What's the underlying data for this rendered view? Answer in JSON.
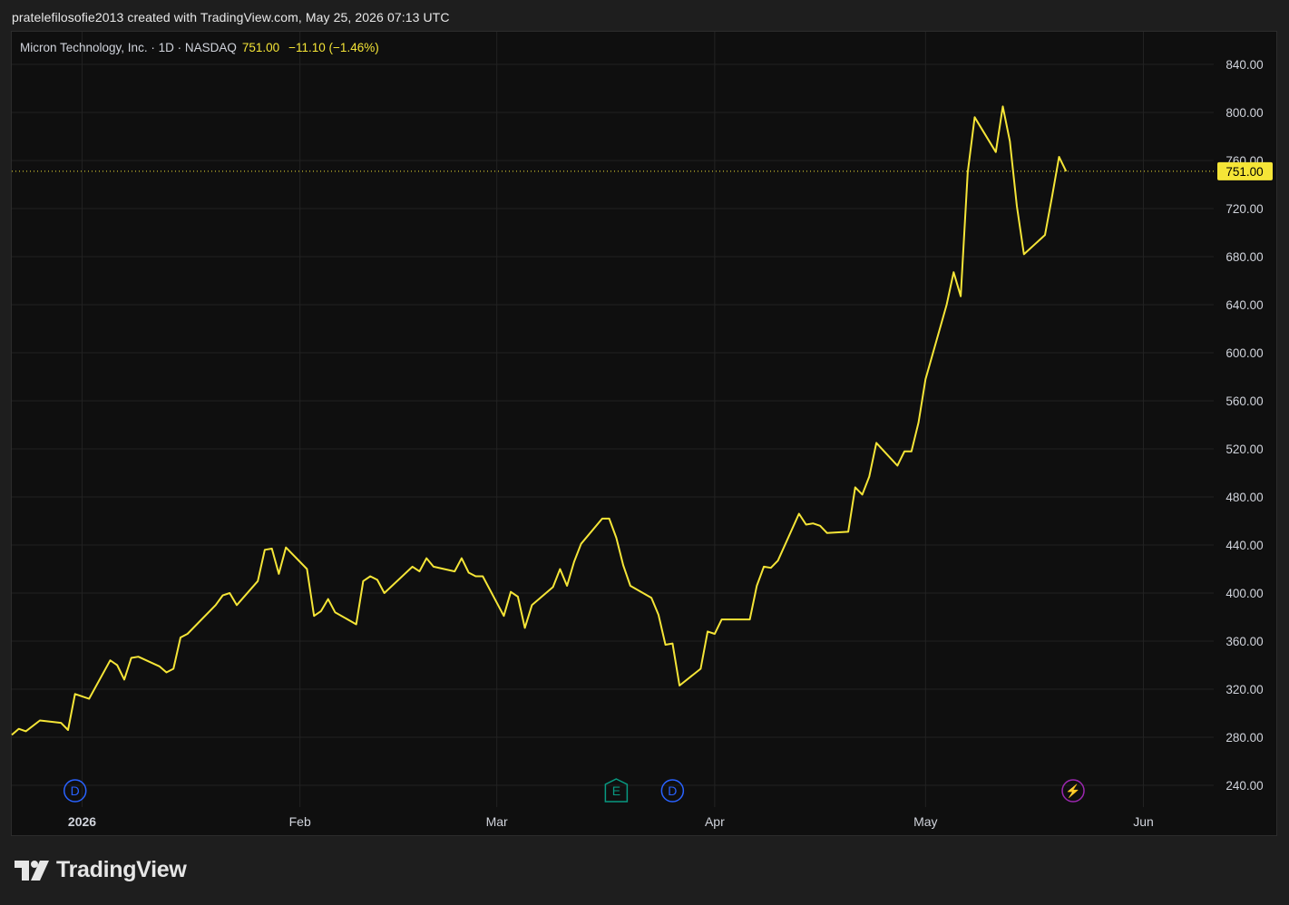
{
  "header": {
    "caption": "pratelefilosofie2013 created with TradingView.com, May 25, 2026 07:13 UTC"
  },
  "legend": {
    "symbol": "Micron Technology, Inc. · 1D · NASDAQ",
    "price": "751.00",
    "change": "−11.10 (−1.46%)"
  },
  "logo": {
    "text": "TradingView"
  },
  "colors": {
    "line": "#f5e537",
    "background": "#0f0f0f",
    "grid": "#222222",
    "dividend_marker": "#2962ff",
    "earnings_marker": "#089981",
    "split_marker": "#9c27b0"
  },
  "chart_data": {
    "type": "line",
    "title": "Micron Technology, Inc. · 1D · NASDAQ",
    "last_price_label": "751.00",
    "ylim": [
      220,
      860
    ],
    "y_ticks": [
      "840.00",
      "800.00",
      "760.00",
      "720.00",
      "680.00",
      "640.00",
      "600.00",
      "560.00",
      "520.00",
      "480.00",
      "440.00",
      "400.00",
      "360.00",
      "320.00",
      "280.00",
      "240.00"
    ],
    "x_ticks": [
      {
        "label": "2026",
        "date": "2026-01-01",
        "bold": true
      },
      {
        "label": "Feb",
        "date": "2026-02-01"
      },
      {
        "label": "Mar",
        "date": "2026-03-01"
      },
      {
        "label": "Apr",
        "date": "2026-04-01"
      },
      {
        "label": "May",
        "date": "2026-05-01"
      },
      {
        "label": "Jun",
        "date": "2026-06-01"
      }
    ],
    "xlim": [
      "2025-12-22",
      "2026-06-11"
    ],
    "grid": true,
    "markers": [
      {
        "type": "D",
        "date": "2025-12-31",
        "kind": "dividend"
      },
      {
        "type": "E",
        "date": "2026-03-18",
        "kind": "earnings"
      },
      {
        "type": "D",
        "date": "2026-03-26",
        "kind": "dividend"
      },
      {
        "type": "⚡",
        "date": "2026-05-22",
        "kind": "split"
      }
    ],
    "series": [
      {
        "points": [
          [
            "2025-12-22",
            282
          ],
          [
            "2025-12-23",
            287
          ],
          [
            "2025-12-24",
            285
          ],
          [
            "2025-12-26",
            294
          ],
          [
            "2025-12-29",
            292
          ],
          [
            "2025-12-30",
            286
          ],
          [
            "2025-12-31",
            316
          ],
          [
            "2026-01-02",
            312
          ],
          [
            "2026-01-05",
            344
          ],
          [
            "2026-01-06",
            340
          ],
          [
            "2026-01-07",
            328
          ],
          [
            "2026-01-08",
            346
          ],
          [
            "2026-01-09",
            347
          ],
          [
            "2026-01-12",
            339
          ],
          [
            "2026-01-13",
            334
          ],
          [
            "2026-01-14",
            337
          ],
          [
            "2026-01-15",
            363
          ],
          [
            "2026-01-16",
            366
          ],
          [
            "2026-01-20",
            390
          ],
          [
            "2026-01-21",
            398
          ],
          [
            "2026-01-22",
            400
          ],
          [
            "2026-01-23",
            390
          ],
          [
            "2026-01-26",
            410
          ],
          [
            "2026-01-27",
            436
          ],
          [
            "2026-01-28",
            437
          ],
          [
            "2026-01-29",
            416
          ],
          [
            "2026-01-30",
            438
          ],
          [
            "2026-02-02",
            420
          ],
          [
            "2026-02-03",
            381
          ],
          [
            "2026-02-04",
            385
          ],
          [
            "2026-02-05",
            395
          ],
          [
            "2026-02-06",
            384
          ],
          [
            "2026-02-09",
            374
          ],
          [
            "2026-02-10",
            410
          ],
          [
            "2026-02-11",
            414
          ],
          [
            "2026-02-12",
            411
          ],
          [
            "2026-02-13",
            400
          ],
          [
            "2026-02-17",
            422
          ],
          [
            "2026-02-18",
            418
          ],
          [
            "2026-02-19",
            429
          ],
          [
            "2026-02-20",
            422
          ],
          [
            "2026-02-23",
            418
          ],
          [
            "2026-02-24",
            429
          ],
          [
            "2026-02-25",
            417
          ],
          [
            "2026-02-26",
            414
          ],
          [
            "2026-02-27",
            414
          ],
          [
            "2026-03-02",
            381
          ],
          [
            "2026-03-03",
            401
          ],
          [
            "2026-03-04",
            397
          ],
          [
            "2026-03-05",
            371
          ],
          [
            "2026-03-06",
            390
          ],
          [
            "2026-03-09",
            405
          ],
          [
            "2026-03-10",
            420
          ],
          [
            "2026-03-11",
            406
          ],
          [
            "2026-03-12",
            426
          ],
          [
            "2026-03-13",
            441
          ],
          [
            "2026-03-16",
            462
          ],
          [
            "2026-03-17",
            462
          ],
          [
            "2026-03-18",
            446
          ],
          [
            "2026-03-19",
            423
          ],
          [
            "2026-03-20",
            406
          ],
          [
            "2026-03-23",
            396
          ],
          [
            "2026-03-24",
            382
          ],
          [
            "2026-03-25",
            357
          ],
          [
            "2026-03-26",
            358
          ],
          [
            "2026-03-27",
            323
          ],
          [
            "2026-03-30",
            337
          ],
          [
            "2026-03-31",
            368
          ],
          [
            "2026-04-01",
            366
          ],
          [
            "2026-04-02",
            378
          ],
          [
            "2026-04-06",
            378
          ],
          [
            "2026-04-07",
            406
          ],
          [
            "2026-04-08",
            422
          ],
          [
            "2026-04-09",
            421
          ],
          [
            "2026-04-10",
            427
          ],
          [
            "2026-04-13",
            466
          ],
          [
            "2026-04-14",
            457
          ],
          [
            "2026-04-15",
            458
          ],
          [
            "2026-04-16",
            456
          ],
          [
            "2026-04-17",
            450
          ],
          [
            "2026-04-20",
            451
          ],
          [
            "2026-04-21",
            488
          ],
          [
            "2026-04-22",
            482
          ],
          [
            "2026-04-23",
            497
          ],
          [
            "2026-04-24",
            525
          ],
          [
            "2026-04-27",
            506
          ],
          [
            "2026-04-28",
            518
          ],
          [
            "2026-04-29",
            518
          ],
          [
            "2026-04-30",
            542
          ],
          [
            "2026-05-01",
            578
          ],
          [
            "2026-05-04",
            640
          ],
          [
            "2026-05-05",
            667
          ],
          [
            "2026-05-06",
            647
          ],
          [
            "2026-05-07",
            750
          ],
          [
            "2026-05-08",
            796
          ],
          [
            "2026-05-11",
            767
          ],
          [
            "2026-05-12",
            805
          ],
          [
            "2026-05-13",
            776
          ],
          [
            "2026-05-14",
            722
          ],
          [
            "2026-05-15",
            682
          ],
          [
            "2026-05-18",
            698
          ],
          [
            "2026-05-19",
            730
          ],
          [
            "2026-05-20",
            763
          ],
          [
            "2026-05-21",
            751
          ]
        ]
      }
    ]
  }
}
